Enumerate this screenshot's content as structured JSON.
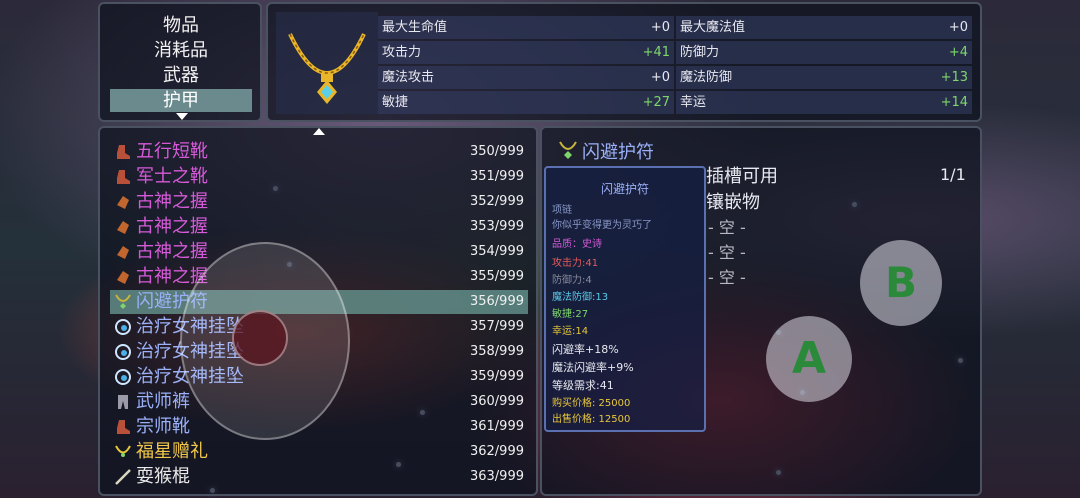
{
  "categories": [
    {
      "label": "物品",
      "selected": false
    },
    {
      "label": "消耗品",
      "selected": false
    },
    {
      "label": "武器",
      "selected": false
    },
    {
      "label": "护甲",
      "selected": true
    }
  ],
  "stats": [
    {
      "name": "最大生命值",
      "value": "+0"
    },
    {
      "name": "最大魔法值",
      "value": "+0"
    },
    {
      "name": "攻击力",
      "value": "+41"
    },
    {
      "name": "防御力",
      "value": "+4"
    },
    {
      "name": "魔法攻击",
      "value": "+0"
    },
    {
      "name": "魔法防御",
      "value": "+13"
    },
    {
      "name": "敏捷",
      "value": "+27"
    },
    {
      "name": "幸运",
      "value": "+14"
    }
  ],
  "items": [
    {
      "name": "五行短靴",
      "count": "350/999",
      "color": "purple",
      "icon": "boot-icon",
      "selected": false
    },
    {
      "name": "军士之靴",
      "count": "351/999",
      "color": "purple",
      "icon": "boot-icon",
      "selected": false
    },
    {
      "name": "古神之握",
      "count": "352/999",
      "color": "purple",
      "icon": "gauntlet-icon",
      "selected": false
    },
    {
      "name": "古神之握",
      "count": "353/999",
      "color": "purple",
      "icon": "gauntlet-icon",
      "selected": false
    },
    {
      "name": "古神之握",
      "count": "354/999",
      "color": "purple",
      "icon": "gauntlet-icon",
      "selected": false
    },
    {
      "name": "古神之握",
      "count": "355/999",
      "color": "purple",
      "icon": "gauntlet-icon",
      "selected": false
    },
    {
      "name": "闪避护符",
      "count": "356/999",
      "color": "blue",
      "icon": "amulet-icon",
      "selected": true
    },
    {
      "name": "治疗女神挂坠",
      "count": "357/999",
      "color": "blue",
      "icon": "pendant-icon",
      "selected": false
    },
    {
      "name": "治疗女神挂坠",
      "count": "358/999",
      "color": "blue",
      "icon": "pendant-icon",
      "selected": false
    },
    {
      "name": "治疗女神挂坠",
      "count": "359/999",
      "color": "blue",
      "icon": "pendant-icon",
      "selected": false
    },
    {
      "name": "武师裤",
      "count": "360/999",
      "color": "blue",
      "icon": "pants-icon",
      "selected": false
    },
    {
      "name": "宗师靴",
      "count": "361/999",
      "color": "blue",
      "icon": "boot-icon",
      "selected": false
    },
    {
      "name": "福星赠礼",
      "count": "362/999",
      "color": "gold",
      "icon": "necklace-icon",
      "selected": false
    },
    {
      "name": "耍猴棍",
      "count": "363/999",
      "color": "white",
      "icon": "staff-icon",
      "selected": false
    }
  ],
  "detail": {
    "title": "闪避护符",
    "tooltip": {
      "header": "闪避护符",
      "type": "项链",
      "desc": "你似乎变得更为灵巧了",
      "quality": "品质：史诗",
      "attack": "攻击力:41",
      "defense": "防御力:4",
      "mdef": "魔法防御:13",
      "agility": "敏捷:27",
      "luck": "幸运:14",
      "dodge": "闪避率+18%",
      "mdodge": "魔法闪避率+9%",
      "level": "等级需求:41",
      "buy": "购买价格:  25000",
      "sell": "出售价格:  12500"
    },
    "socket_label": "插槽可用",
    "socket_count": "1/1",
    "inlay_label": "镶嵌物",
    "empty_slots": [
      "- 空 -",
      "- 空 -",
      "- 空 -"
    ]
  },
  "buttons": {
    "a": "A",
    "b": "B"
  },
  "colors": {
    "purple": "#d65ad8",
    "blue": "#9ab0f8",
    "gold": "#f2c84a",
    "green_value": "#7ed66a",
    "selected_row": "#6a9c96"
  }
}
